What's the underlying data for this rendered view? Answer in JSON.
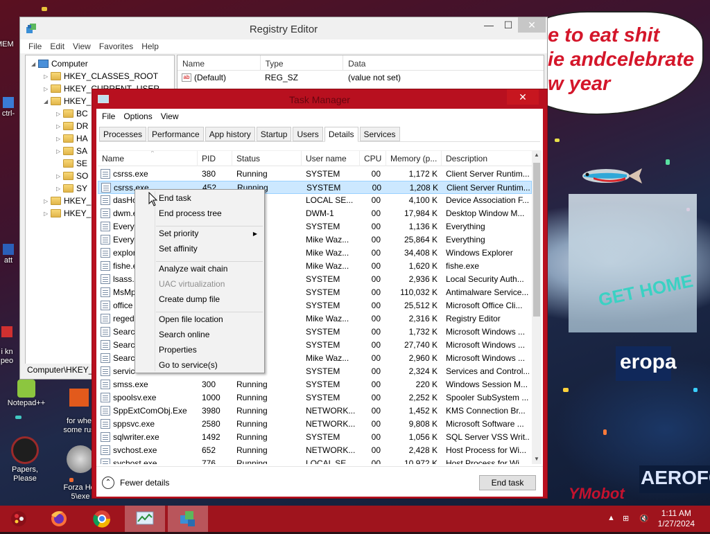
{
  "bubble_text": "e to eat shit\nie andcelebrate\nw year",
  "billboard_texts": [
    "GET HOME",
    "eropa",
    "AEROFOS",
    "YMobot"
  ],
  "desktop_icons": [
    {
      "label": "MEM"
    },
    {
      "label": "ctrl-"
    },
    {
      "label": "att"
    },
    {
      "label": "i kn\npeo"
    },
    {
      "label": "Notepad++"
    },
    {
      "label": "for whe\nsome rus"
    },
    {
      "label": "Papers, Please"
    },
    {
      "label": "Forza Hor\n5\\exe"
    }
  ],
  "registry": {
    "title": "Registry Editor",
    "menu": [
      "File",
      "Edit",
      "View",
      "Favorites",
      "Help"
    ],
    "tree": [
      {
        "label": "Computer",
        "indent": 0,
        "twisty": "◢",
        "type": "computer"
      },
      {
        "label": "HKEY_CLASSES_ROOT",
        "indent": 1,
        "twisty": "▷"
      },
      {
        "label": "HKEY_CURRENT_USER",
        "indent": 1,
        "twisty": "▷"
      },
      {
        "label": "HKEY_",
        "indent": 1,
        "twisty": "◢"
      },
      {
        "label": "BC",
        "indent": 2,
        "twisty": "▷"
      },
      {
        "label": "DR",
        "indent": 2,
        "twisty": "▷"
      },
      {
        "label": "HA",
        "indent": 2,
        "twisty": "▷"
      },
      {
        "label": "SA",
        "indent": 2,
        "twisty": "▷"
      },
      {
        "label": "SE",
        "indent": 2,
        "twisty": ""
      },
      {
        "label": "SO",
        "indent": 2,
        "twisty": "▷"
      },
      {
        "label": "SY",
        "indent": 2,
        "twisty": "▷"
      },
      {
        "label": "HKEY_",
        "indent": 1,
        "twisty": "▷"
      },
      {
        "label": "HKEY_",
        "indent": 1,
        "twisty": "▷"
      }
    ],
    "columns": [
      "Name",
      "Type",
      "Data"
    ],
    "rows": [
      {
        "name": "(Default)",
        "type": "REG_SZ",
        "data": "(value not set)"
      }
    ],
    "status": "Computer\\HKEY_"
  },
  "taskmgr": {
    "title": "Task Manager",
    "menu": [
      "File",
      "Options",
      "View"
    ],
    "tabs": [
      "Processes",
      "Performance",
      "App history",
      "Startup",
      "Users",
      "Details",
      "Services"
    ],
    "active_tab": "Details",
    "columns": [
      "Name",
      "PID",
      "Status",
      "User name",
      "CPU",
      "Memory (p...",
      "Description"
    ],
    "rows": [
      {
        "name": "csrss.exe",
        "pid": "380",
        "status": "Running",
        "user": "SYSTEM",
        "cpu": "00",
        "mem": "1,172 K",
        "desc": "Client Server Runtim..."
      },
      {
        "name": "csrss.exe",
        "pid": "452",
        "status": "Running",
        "user": "SYSTEM",
        "cpu": "00",
        "mem": "1,208 K",
        "desc": "Client Server Runtim...",
        "selected": true
      },
      {
        "name": "dasHos",
        "pid": "",
        "status": "",
        "user": "LOCAL SE...",
        "cpu": "00",
        "mem": "4,100 K",
        "desc": "Device Association F..."
      },
      {
        "name": "dwm.e",
        "pid": "",
        "status": "",
        "user": "DWM-1",
        "cpu": "00",
        "mem": "17,984 K",
        "desc": "Desktop Window M..."
      },
      {
        "name": "Everyt",
        "pid": "",
        "status": "",
        "user": "SYSTEM",
        "cpu": "00",
        "mem": "1,136 K",
        "desc": "Everything"
      },
      {
        "name": "Everyt",
        "pid": "",
        "status": "",
        "user": "Mike Waz...",
        "cpu": "00",
        "mem": "25,864 K",
        "desc": "Everything"
      },
      {
        "name": "explor",
        "pid": "",
        "status": "",
        "user": "Mike Waz...",
        "cpu": "00",
        "mem": "34,408 K",
        "desc": "Windows Explorer"
      },
      {
        "name": "fishe.e",
        "pid": "",
        "status": "",
        "user": "Mike Waz...",
        "cpu": "00",
        "mem": "1,620 K",
        "desc": "fishe.exe"
      },
      {
        "name": "lsass.e",
        "pid": "",
        "status": "",
        "user": "SYSTEM",
        "cpu": "00",
        "mem": "2,936 K",
        "desc": "Local Security Auth..."
      },
      {
        "name": "MsMp",
        "pid": "",
        "status": "",
        "user": "SYSTEM",
        "cpu": "00",
        "mem": "110,032 K",
        "desc": "Antimalware Service..."
      },
      {
        "name": "office",
        "pid": "",
        "status": "",
        "user": "SYSTEM",
        "cpu": "00",
        "mem": "25,512 K",
        "desc": "Microsoft Office Cli..."
      },
      {
        "name": "regedi",
        "pid": "",
        "status": "",
        "user": "Mike Waz...",
        "cpu": "00",
        "mem": "2,316 K",
        "desc": "Registry Editor"
      },
      {
        "name": "Search",
        "pid": "",
        "status": "",
        "user": "SYSTEM",
        "cpu": "00",
        "mem": "1,732 K",
        "desc": "Microsoft Windows ..."
      },
      {
        "name": "Search",
        "pid": "",
        "status": "",
        "user": "SYSTEM",
        "cpu": "00",
        "mem": "27,740 K",
        "desc": "Microsoft Windows ..."
      },
      {
        "name": "Search",
        "pid": "",
        "status": "",
        "user": "Mike Waz...",
        "cpu": "00",
        "mem": "2,960 K",
        "desc": "Microsoft Windows ..."
      },
      {
        "name": "servic",
        "pid": "",
        "status": "",
        "user": "SYSTEM",
        "cpu": "00",
        "mem": "2,324 K",
        "desc": "Services and Control..."
      },
      {
        "name": "smss.exe",
        "pid": "300",
        "status": "Running",
        "user": "SYSTEM",
        "cpu": "00",
        "mem": "220 K",
        "desc": "Windows Session M..."
      },
      {
        "name": "spoolsv.exe",
        "pid": "1000",
        "status": "Running",
        "user": "SYSTEM",
        "cpu": "00",
        "mem": "2,252 K",
        "desc": "Spooler SubSystem ..."
      },
      {
        "name": "SppExtComObj.Exe",
        "pid": "3980",
        "status": "Running",
        "user": "NETWORK...",
        "cpu": "00",
        "mem": "1,452 K",
        "desc": "KMS Connection Br..."
      },
      {
        "name": "sppsvc.exe",
        "pid": "2580",
        "status": "Running",
        "user": "NETWORK...",
        "cpu": "00",
        "mem": "9,808 K",
        "desc": "Microsoft Software ..."
      },
      {
        "name": "sqlwriter.exe",
        "pid": "1492",
        "status": "Running",
        "user": "SYSTEM",
        "cpu": "00",
        "mem": "1,056 K",
        "desc": "SQL Server VSS Writ..."
      },
      {
        "name": "svchost.exe",
        "pid": "652",
        "status": "Running",
        "user": "NETWORK...",
        "cpu": "00",
        "mem": "2,428 K",
        "desc": "Host Process for Wi..."
      },
      {
        "name": "svchost.exe",
        "pid": "776",
        "status": "Running",
        "user": "LOCAL SE...",
        "cpu": "00",
        "mem": "10,972 K",
        "desc": "Host Process for Wi..."
      }
    ],
    "fewer_details": "Fewer details",
    "end_task_button": "End task"
  },
  "context_menu": [
    {
      "label": "End task",
      "enabled": true
    },
    {
      "label": "End process tree",
      "enabled": true
    },
    {
      "sep": true
    },
    {
      "label": "Set priority",
      "enabled": true,
      "submenu": true
    },
    {
      "label": "Set affinity",
      "enabled": true
    },
    {
      "sep": true
    },
    {
      "label": "Analyze wait chain",
      "enabled": true
    },
    {
      "label": "UAC virtualization",
      "enabled": false
    },
    {
      "label": "Create dump file",
      "enabled": true
    },
    {
      "sep": true
    },
    {
      "label": "Open file location",
      "enabled": true
    },
    {
      "label": "Search online",
      "enabled": true
    },
    {
      "label": "Properties",
      "enabled": true
    },
    {
      "label": "Go to service(s)",
      "enabled": true
    }
  ],
  "taskbar": {
    "items": [
      "start-orb",
      "firefox",
      "chrome",
      "task-manager",
      "registry-editor"
    ],
    "active": [
      "task-manager",
      "registry-editor"
    ],
    "time": "1:11 AM",
    "date": "1/27/2024"
  },
  "colors": {
    "taskbar": "#9f141d",
    "tm_frame": "#b8101f",
    "selection": "#cce8ff"
  }
}
